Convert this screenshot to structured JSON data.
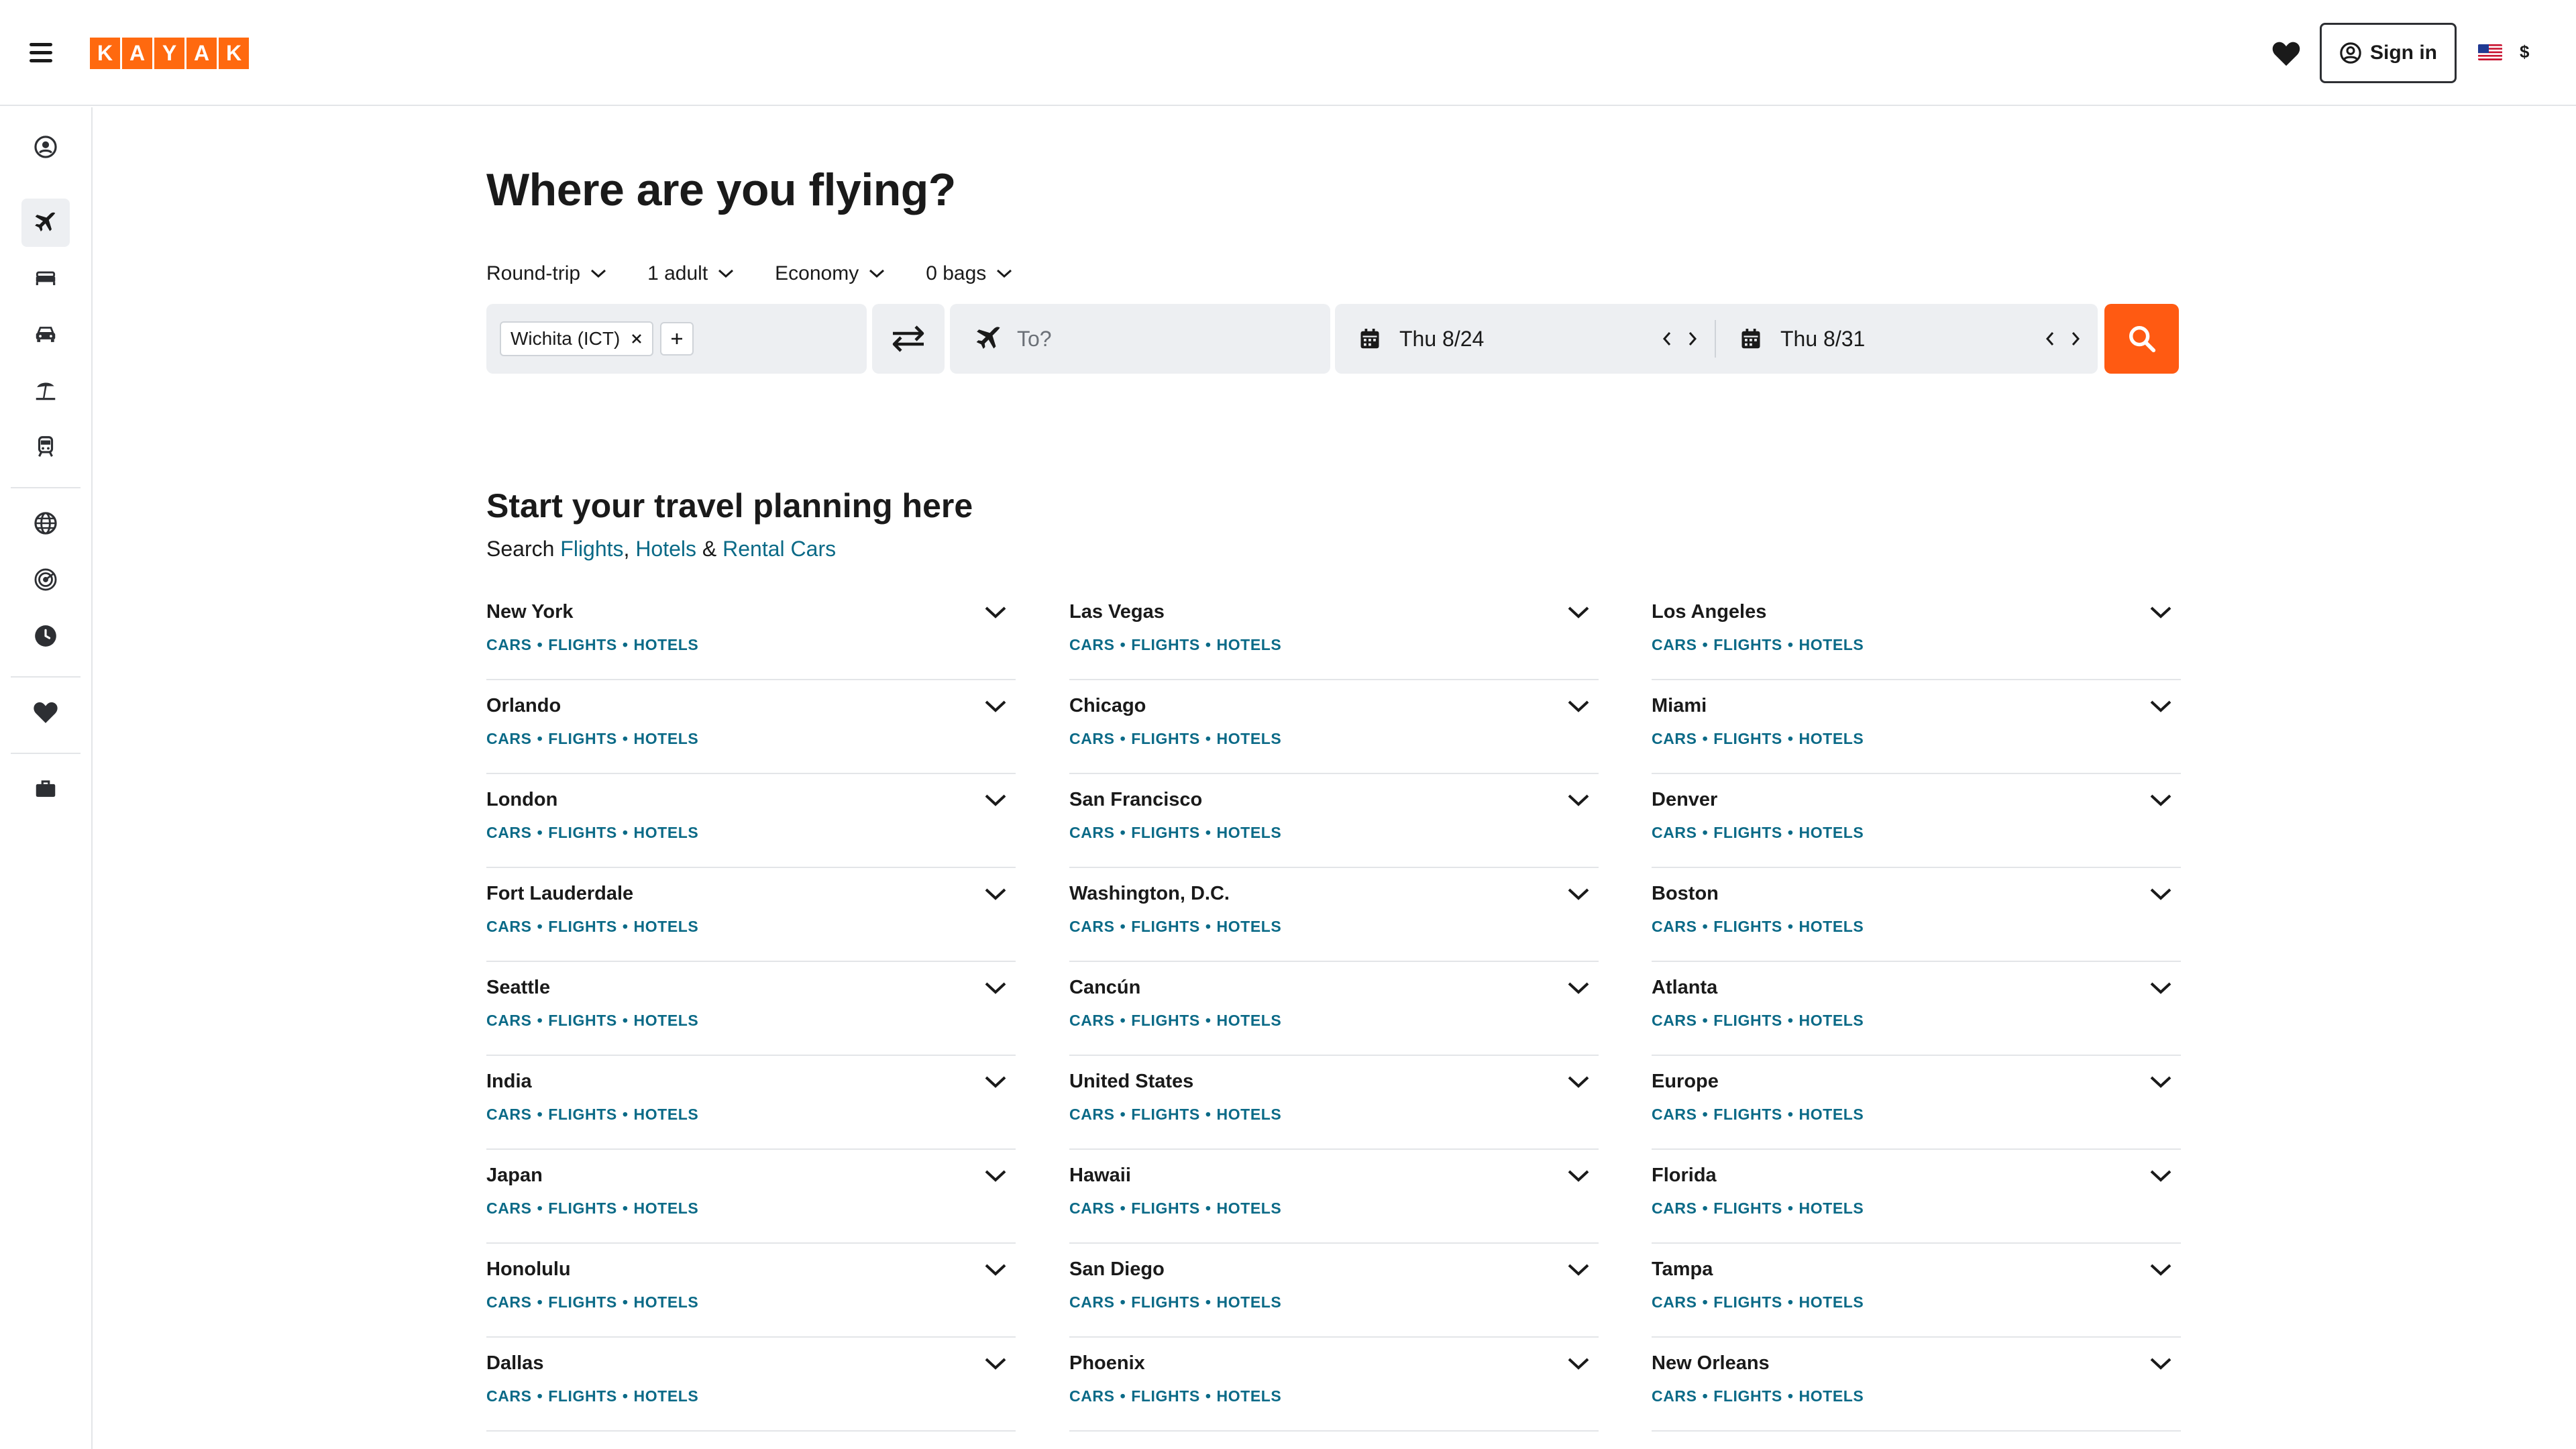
{
  "header": {
    "logo_letters": [
      "K",
      "A",
      "Y",
      "A",
      "K"
    ],
    "signin_label": "Sign in",
    "currency": "$",
    "brand_color": "#ff690f"
  },
  "search": {
    "title": "Where are you flying?",
    "options": {
      "trip_type": "Round-trip",
      "travelers": "1 adult",
      "cabin": "Economy",
      "bags": "0 bags"
    },
    "origin_chip": "Wichita (ICT)",
    "destination_placeholder": "To?",
    "depart_date": "Thu 8/24",
    "return_date": "Thu 8/31",
    "button_color": "#ff5a12"
  },
  "explore": {
    "title": "Start your travel planning here",
    "sub_prefix": "Search",
    "sub_links": [
      "Flights",
      "Hotels",
      "Rental Cars"
    ],
    "sub_sep1": ", ",
    "sub_sep2": " & ",
    "link_labels": [
      "CARS",
      "FLIGHTS",
      "HOTELS"
    ],
    "link_separator": "•",
    "cities": [
      "New York",
      "Las Vegas",
      "Los Angeles",
      "Orlando",
      "Chicago",
      "Miami",
      "London",
      "San Francisco",
      "Denver",
      "Fort Lauderdale",
      "Washington, D.C.",
      "Boston",
      "Seattle",
      "Cancún",
      "Atlanta",
      "India",
      "United States",
      "Europe",
      "Japan",
      "Hawaii",
      "Florida",
      "Honolulu",
      "San Diego",
      "Tampa",
      "Dallas",
      "Phoenix",
      "New Orleans"
    ]
  },
  "sidebar": {
    "items": [
      "account-icon",
      "flights-icon",
      "hotels-icon",
      "cars-icon",
      "packages-icon",
      "trains-icon",
      "explore-icon",
      "trips-radar-icon",
      "history-icon",
      "saved-heart-icon",
      "trips-briefcase-icon"
    ],
    "active": "flights-icon"
  }
}
